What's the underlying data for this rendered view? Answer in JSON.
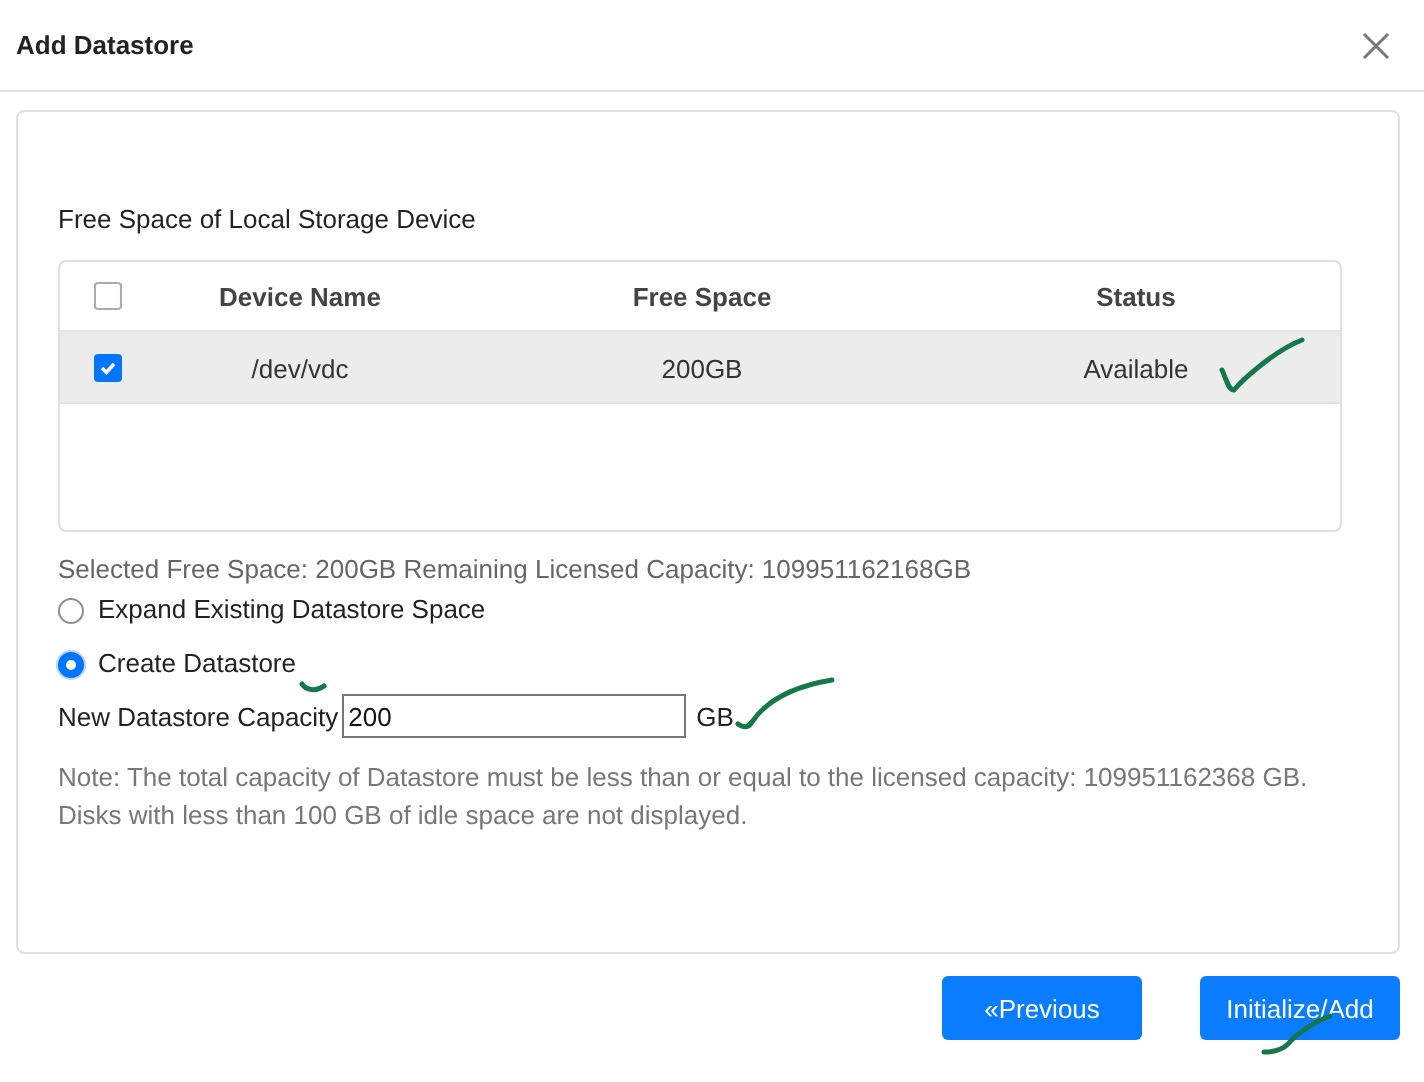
{
  "window": {
    "title": "Add Datastore"
  },
  "section_title": "Free Space of Local Storage Device",
  "table": {
    "select_all": {
      "checked": false
    },
    "columns": [
      "Device Name",
      "Free Space",
      "Status"
    ],
    "rows": [
      {
        "checked": true,
        "cells": [
          "/dev/vdc",
          "200GB",
          "Available"
        ]
      }
    ]
  },
  "summary": "Selected Free Space: 200GB Remaining Licensed Capacity: 109951162168GB",
  "options": [
    {
      "label": "Expand Existing Datastore Space",
      "selected": false
    },
    {
      "label": "Create Datastore",
      "selected": true
    }
  ],
  "capacity": {
    "label": "New Datastore Capacity",
    "value": "200",
    "unit": "GB"
  },
  "notes": [
    "Note: The total capacity of Datastore must be less than or equal to the licensed capacity: 109951162368 GB.",
    "Disks with less than 100 GB of idle space are not displayed."
  ],
  "buttons": [
    "«Previous",
    "Initialize/Add"
  ]
}
